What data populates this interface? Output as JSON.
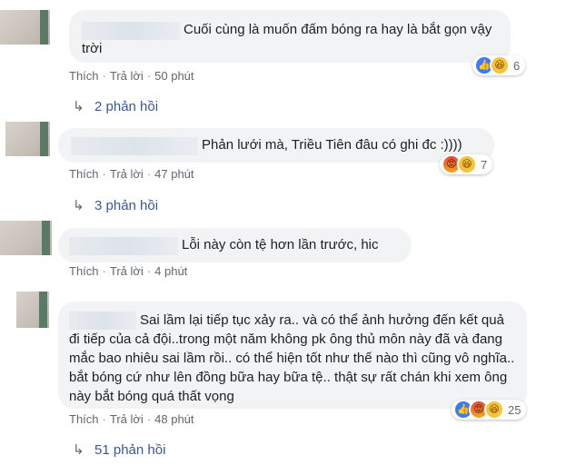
{
  "actions": {
    "like": "Thích",
    "reply": "Trả lời",
    "separator": "·"
  },
  "comments": [
    {
      "text": "Cuối cùng là muốn đấm bóng ra hay là bắt gọn vậy trời",
      "time": "50 phút",
      "reactions": [
        "like-icon",
        "haha-icon"
      ],
      "reaction_count": "6",
      "replies": "2 phản hồi"
    },
    {
      "text": "Phản lưới mà, Triều Tiên đâu có ghi đc :))))",
      "time": "47 phút",
      "reactions": [
        "angry-icon",
        "haha-icon"
      ],
      "reaction_count": "7",
      "replies": "3 phản hồi"
    },
    {
      "text": "Lỗi này còn tệ hơn lần trước, hic",
      "time": "4 phút"
    },
    {
      "text": "Sai lầm lại tiếp tục xảy ra.. và có thể ảnh hưởng đến kết quả đi tiếp của cả đội..trong một năm không pk ông thủ môn này đã và đang mắc bao nhiêu sai lầm rồi.. có thể hiện tốt như thế nào thì cũng vô nghĩa.. bắt bóng cứ như lên đồng bữa hay bữa tệ.. thật sự rất chán khi xem ông này bắt bóng quá thất vọng",
      "time": "48 phút",
      "reactions": [
        "like-icon",
        "angry-icon",
        "haha-icon"
      ],
      "reaction_count": "25",
      "replies": "51 phản hồi"
    }
  ]
}
